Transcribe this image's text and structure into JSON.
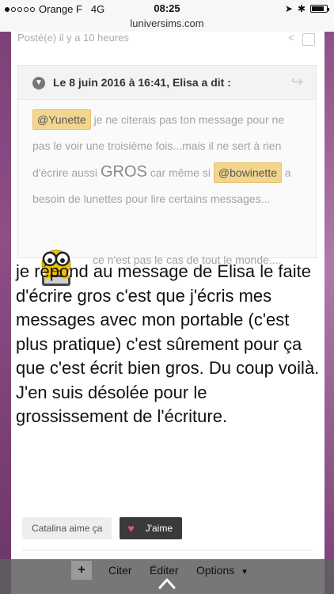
{
  "status_bar": {
    "carrier": "Orange F",
    "network": "4G",
    "time": "08:25",
    "battery_level": 0.85
  },
  "browser": {
    "url": "luniversims.com"
  },
  "previous_post": {
    "meta_text": "Posté(e) il y a 10 heures"
  },
  "quote": {
    "attribution": "Le 8 juin 2016 à 16:41, Elisa a dit :",
    "mention1": "@Yunette",
    "text1": " je ne citerais pas ton message pour ne pas le voir une troisième fois...mais il ne sert à rien d'écrire aussi ",
    "big_word": "GROS",
    "text2": " car même si ",
    "mention2": "@bowinette",
    "text3": " a besoin de lunettes pour lire certains messages...",
    "last_line": "ce n'est pas le cas de tout le monde...."
  },
  "message": {
    "text": "je répond au message de Elisa le faite d'écrire gros c'est que j'écris mes messages avec mon portable (c'est plus pratique) c'est sûrement pour ça que c'est écrit bien gros. Du coup voilà. J'en suis désolée pour le grossissement de l'écriture."
  },
  "reactions": {
    "liker_name": "Catalina",
    "liker_suffix": " aime ça",
    "like_button_label": "J'aime"
  },
  "bottom_bar": {
    "plus_label": "+",
    "quote_label": "Citer",
    "edit_label": "Éditer",
    "options_label": "Options"
  },
  "colors": {
    "page_purple": "#6f3a6c",
    "mention_bg": "#f3d58e",
    "heart": "#e05a6a"
  }
}
